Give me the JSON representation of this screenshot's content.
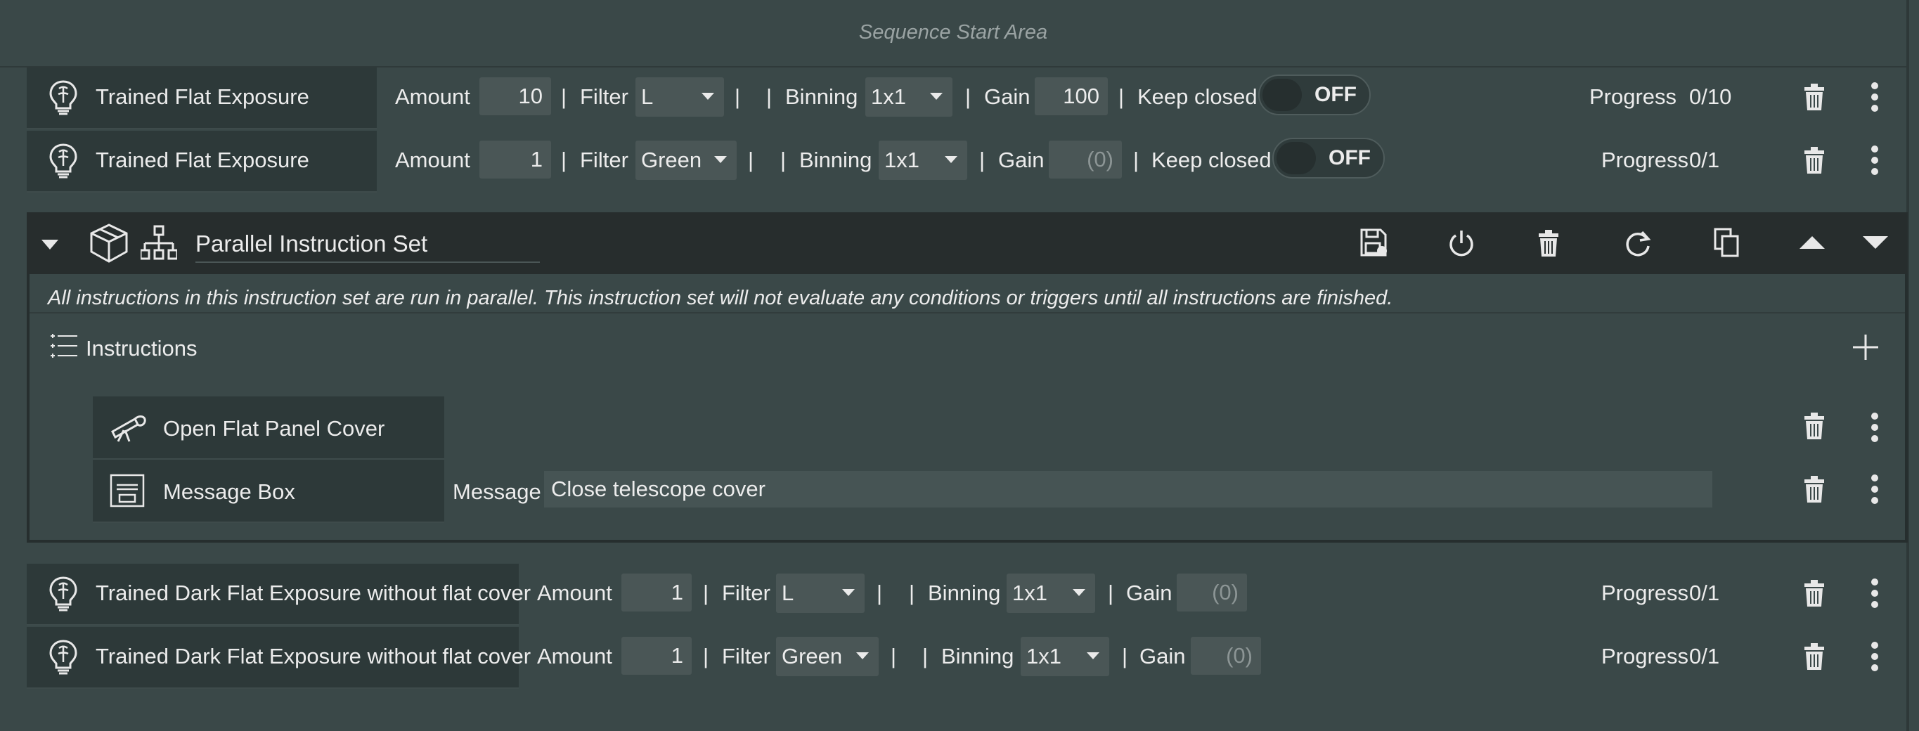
{
  "sequence_start_area": "Sequence Start Area",
  "flat_rows": [
    {
      "name": "Trained Flat Exposure",
      "amount_label": "Amount",
      "amount": "10",
      "filter_label": "Filter",
      "filter": "L",
      "binning_label": "Binning",
      "binning": "1x1",
      "gain_label": "Gain",
      "gain": "100",
      "keep_closed_label": "Keep closed",
      "toggle": "OFF",
      "progress_label": "Progress",
      "progress": "0/10"
    },
    {
      "name": "Trained Flat Exposure",
      "amount_label": "Amount",
      "amount": "1",
      "filter_label": "Filter",
      "filter": "Green",
      "binning_label": "Binning",
      "binning": "1x1",
      "gain_label": "Gain",
      "gain": "(0)",
      "keep_closed_label": "Keep closed",
      "toggle": "OFF",
      "progress_label": "Progress",
      "progress": "0/1"
    }
  ],
  "separator": "|",
  "parallel": {
    "title": "Parallel Instruction Set",
    "description": "All instructions in this instruction set are run in parallel. This instruction set will not evaluate any conditions or triggers until all instructions are finished.",
    "instructions_label": "Instructions",
    "add_symbol": "+",
    "items": [
      {
        "name": "Open Flat Panel Cover"
      },
      {
        "name": "Message Box",
        "message_label": "Message",
        "message": "Close telescope cover"
      }
    ]
  },
  "dark_rows": [
    {
      "name": "Trained Dark Flat Exposure without flat cover",
      "amount_label": "Amount",
      "amount": "1",
      "filter_label": "Filter",
      "filter": "L",
      "binning_label": "Binning",
      "binning": "1x1",
      "gain_label": "Gain",
      "gain": "(0)",
      "progress_label": "Progress",
      "progress": "0/1"
    },
    {
      "name": "Trained Dark Flat Exposure without flat cover",
      "amount_label": "Amount",
      "amount": "1",
      "filter_label": "Filter",
      "filter": "Green",
      "binning_label": "Binning",
      "binning": "1x1",
      "gain_label": "Gain",
      "gain": "(0)",
      "progress_label": "Progress",
      "progress": "0/1"
    }
  ],
  "colors": {
    "background": "#3a4848",
    "header": "#272d2d",
    "panel": "#2d3939",
    "input": "#4a5656"
  },
  "icons": [
    "lightbulb-brain-icon",
    "trash-icon",
    "more-vertical-icon",
    "chevron-down-icon",
    "box-icon",
    "hierarchy-icon",
    "save-icon",
    "power-icon",
    "refresh-icon",
    "copy-icon",
    "arrow-up-icon",
    "arrow-down-icon",
    "list-icon",
    "plus-icon",
    "telescope-icon",
    "message-box-icon"
  ]
}
